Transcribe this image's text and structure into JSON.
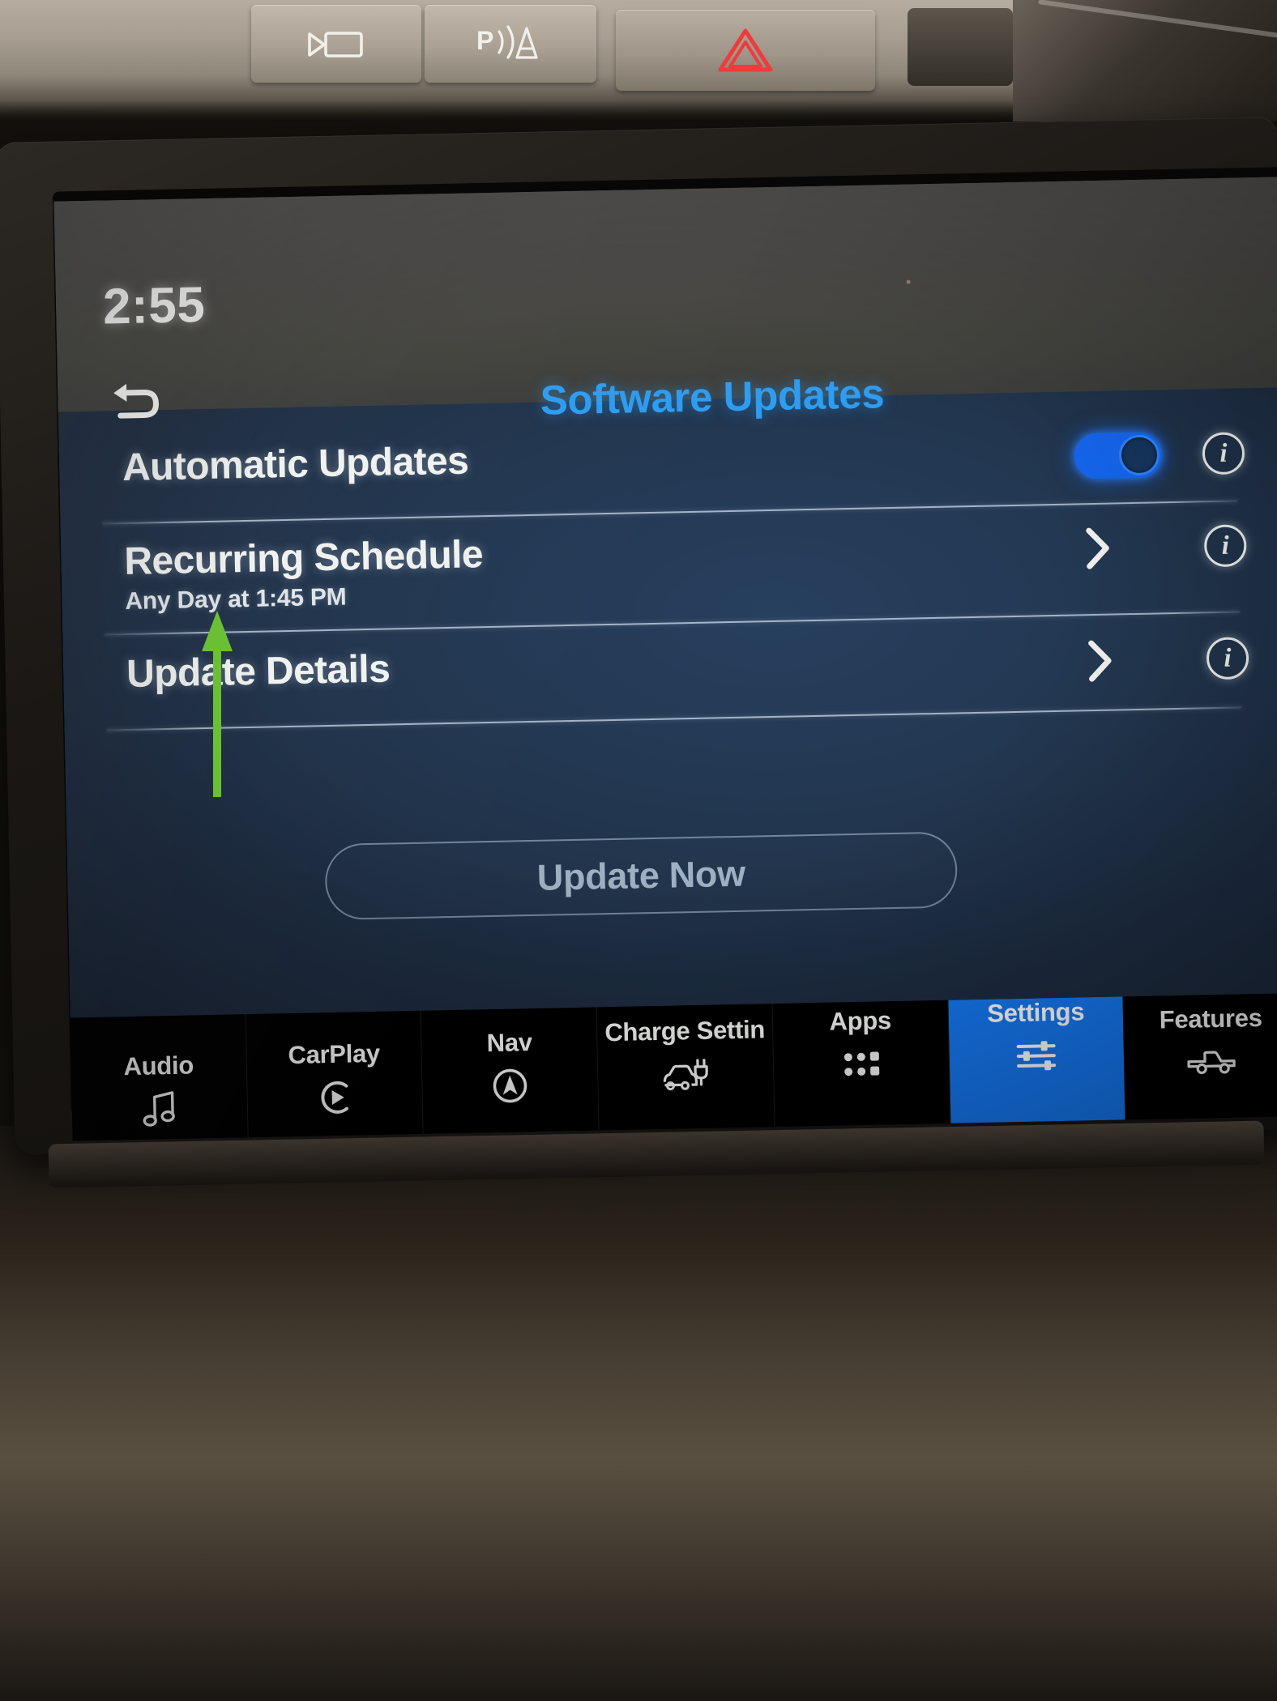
{
  "vehicle_controls": {
    "camera_button": "camera-view-icon",
    "park_assist_button": "park-assist-icon",
    "hazard_button": "hazard-triangle-icon"
  },
  "screen": {
    "status_bar": {
      "clock": "2:55"
    },
    "header": {
      "back_icon": "back-arrow-icon",
      "title": "Software Updates",
      "title_color": "#2f9cf0"
    },
    "list": [
      {
        "title": "Automatic Updates",
        "subtitle": "",
        "control": "toggle",
        "toggle_on": true,
        "toggle_color": "#1567f0",
        "info_icon": "info-circle-icon",
        "info_glyph": "i"
      },
      {
        "title": "Recurring Schedule",
        "subtitle": "Any Day at 1:45 PM",
        "control": "chevron",
        "chevron_icon": "chevron-right-icon",
        "info_icon": "info-circle-icon",
        "info_glyph": "i"
      },
      {
        "title": "Update Details",
        "subtitle": "",
        "control": "chevron",
        "chevron_icon": "chevron-right-icon",
        "info_icon": "info-circle-icon",
        "info_glyph": "i"
      }
    ],
    "update_button": {
      "label": "Update Now",
      "enabled": false
    },
    "bottom_nav": {
      "active_index": 5,
      "active_color": "#1577f0",
      "items": [
        {
          "label": "Audio",
          "icon": "music-note-icon"
        },
        {
          "label": "CarPlay",
          "icon": "carplay-play-circle-icon"
        },
        {
          "label": "Nav",
          "icon": "navigation-arrow-circle-icon"
        },
        {
          "label": "Charge Settin",
          "icon": "ev-charge-car-plug-icon"
        },
        {
          "label": "Apps",
          "icon": "apps-grid-icon"
        },
        {
          "label": "Settings",
          "icon": "sliders-icon"
        },
        {
          "label": "Features",
          "icon": "pickup-truck-icon"
        }
      ]
    }
  },
  "annotation": {
    "arrow": "green-up-arrow",
    "color": "#6abf35",
    "points_to": "Update Details"
  }
}
